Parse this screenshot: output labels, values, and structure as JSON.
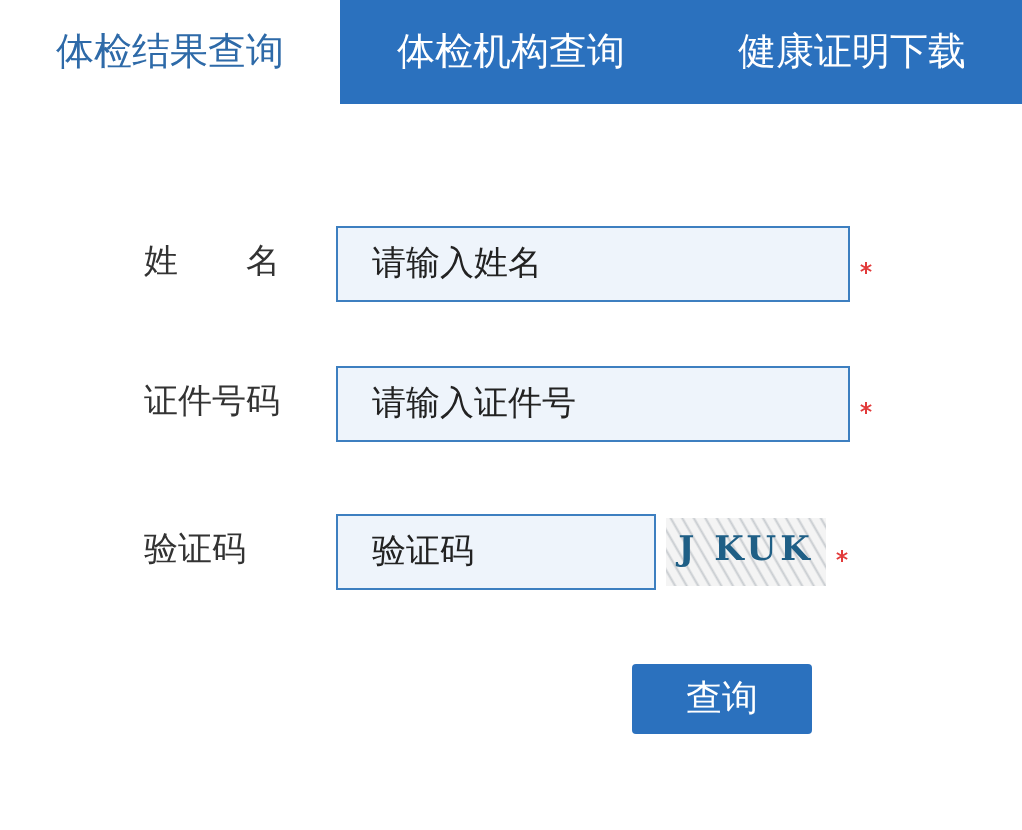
{
  "tabs": [
    {
      "label": "体检结果查询",
      "selected": true
    },
    {
      "label": "体检机构查询",
      "selected": false
    },
    {
      "label": "健康证明下载",
      "selected": false
    }
  ],
  "form": {
    "fields": [
      {
        "kind": "text",
        "label": "姓　　名",
        "placeholder": "请输入姓名",
        "required": true
      },
      {
        "kind": "text",
        "label": "证件号码",
        "placeholder": "请输入证件号",
        "required": true
      },
      {
        "kind": "captcha",
        "label": "验证码",
        "placeholder": "验证码",
        "captcha": "J KUK",
        "required": true
      }
    ],
    "submit": "查询"
  }
}
